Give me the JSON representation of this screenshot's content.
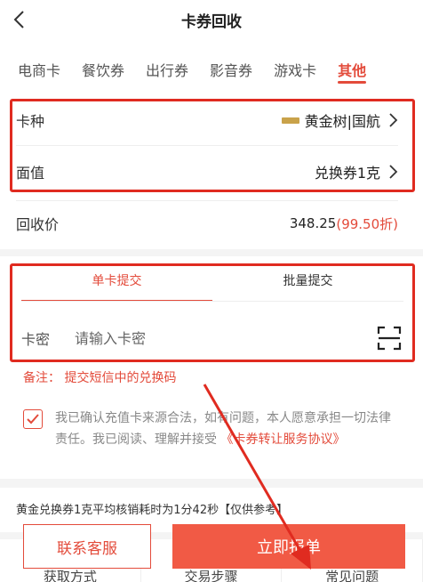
{
  "header": {
    "title": "卡券回收"
  },
  "tabs": [
    {
      "label": "电商卡"
    },
    {
      "label": "餐饮券"
    },
    {
      "label": "出行券"
    },
    {
      "label": "影音券"
    },
    {
      "label": "游戏卡"
    },
    {
      "label": "其他",
      "active": true
    }
  ],
  "card_type": {
    "label": "卡种",
    "value": "黄金树|国航"
  },
  "face_value": {
    "label": "面值",
    "value": "兑换券1克"
  },
  "recycle_price": {
    "label": "回收价",
    "value": "348.25",
    "discount": "(99.50折)"
  },
  "submit_tabs": [
    {
      "label": "单卡提交",
      "active": true
    },
    {
      "label": "批量提交"
    }
  ],
  "card_pin": {
    "label": "卡密",
    "placeholder": "请输入卡密"
  },
  "remark": "备注： 提交短信中的兑换码",
  "agreement": {
    "checked": true,
    "text": "我已确认充值卡来源合法，如有问题，本人愿意承担一切法律责任。我已阅读、理解并接受",
    "link": "《卡券转让服务协议》"
  },
  "note": "黄金兑换券1克平均核销耗时为1分42秒【仅供参考】",
  "bottom_tabs": [
    {
      "label": "获取方式"
    },
    {
      "label": "交易步骤"
    },
    {
      "label": "常见问题"
    }
  ],
  "actions": {
    "service_label": "联系客服",
    "submit_label": "立即报单"
  },
  "colors": {
    "accent": "#e34b3b",
    "annotation_red": "#e02b20",
    "submit_bg": "#f15a45"
  }
}
